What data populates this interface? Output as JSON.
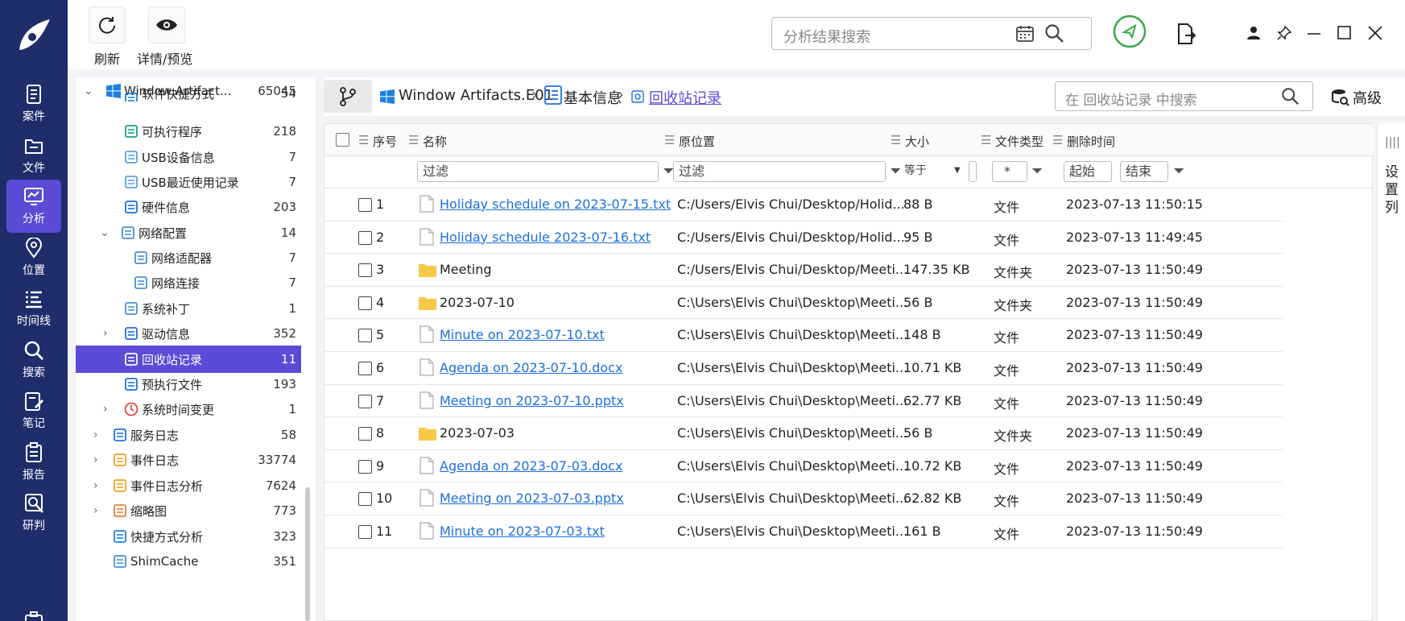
{
  "rail": {
    "items": [
      {
        "label": "案件",
        "icon": "case-icon"
      },
      {
        "label": "文件",
        "icon": "folder-icon"
      },
      {
        "label": "分析",
        "icon": "analysis-icon",
        "active": true
      },
      {
        "label": "位置",
        "icon": "location-icon"
      },
      {
        "label": "时间线",
        "icon": "timeline-icon"
      },
      {
        "label": "搜索",
        "icon": "search-icon"
      },
      {
        "label": "笔记",
        "icon": "note-icon"
      },
      {
        "label": "报告",
        "icon": "report-icon"
      },
      {
        "label": "研判",
        "icon": "judge-icon"
      }
    ]
  },
  "toolbar": {
    "refresh_label": "刷新",
    "preview_label": "详情/预览",
    "search_placeholder": "分析结果搜索"
  },
  "tree": {
    "items": [
      {
        "label": "Window Artifact...",
        "count": "65045",
        "icon": "windows-icon"
      },
      {
        "label": "软件快捷方式",
        "count": "54",
        "icon": "shortcut-icon"
      },
      {
        "label": "可执行程序",
        "count": "218",
        "icon": "exe-icon"
      },
      {
        "label": "USB设备信息",
        "count": "7",
        "icon": "usb-icon"
      },
      {
        "label": "USB最近使用记录",
        "count": "7",
        "icon": "usb-icon"
      },
      {
        "label": "硬件信息",
        "count": "203",
        "icon": "chip-icon"
      },
      {
        "label": "网络配置",
        "count": "14",
        "icon": "network-icon"
      },
      {
        "label": "网络适配器",
        "count": "7",
        "icon": "network-icon"
      },
      {
        "label": "网络连接",
        "count": "7",
        "icon": "network-icon"
      },
      {
        "label": "系统补丁",
        "count": "1",
        "icon": "patch-icon"
      },
      {
        "label": "驱动信息",
        "count": "352",
        "icon": "drive-icon"
      },
      {
        "label": "回收站记录",
        "count": "11",
        "icon": "recycle-icon",
        "selected": true
      },
      {
        "label": "预执行文件",
        "count": "193",
        "icon": "prefetch-icon"
      },
      {
        "label": "系统时间变更",
        "count": "1",
        "icon": "clock-icon"
      },
      {
        "label": "服务日志",
        "count": "58",
        "icon": "service-icon"
      },
      {
        "label": "事件日志",
        "count": "33774",
        "icon": "event-icon"
      },
      {
        "label": "事件日志分析",
        "count": "7624",
        "icon": "event-icon"
      },
      {
        "label": "缩略图",
        "count": "773",
        "icon": "thumb-icon"
      },
      {
        "label": "快捷方式分析",
        "count": "323",
        "icon": "shortcut-icon"
      },
      {
        "label": "ShimCache",
        "count": "351",
        "icon": "shim-icon"
      }
    ]
  },
  "breadcrumb": {
    "items": [
      "Window Artifacts.E01",
      "基本信息",
      "回收站记录"
    ],
    "search_placeholder": "在 回收站记录 中搜索",
    "advanced_label": "高级"
  },
  "grid": {
    "columns": [
      "序号",
      "名称",
      "原位置",
      "大小",
      "文件类型",
      "删除时间"
    ],
    "filters": {
      "name": "过滤",
      "location": "过滤",
      "size_op": "等于",
      "type": "*",
      "start": "起始",
      "end": "结束"
    },
    "rows": [
      {
        "no": "1",
        "name": "Holiday schedule on 2023-07-15.txt",
        "kind": "file",
        "loc": "C:/Users/Elvis Chui/Desktop/Holid...",
        "size": "88 B",
        "type": "文件",
        "time": "2023-07-13 11:50:15"
      },
      {
        "no": "2",
        "name": "Holiday schedule 2023-07-16.txt",
        "kind": "file",
        "loc": "C:/Users/Elvis Chui/Desktop/Holid...",
        "size": "95 B",
        "type": "文件",
        "time": "2023-07-13 11:49:45"
      },
      {
        "no": "3",
        "name": "Meeting",
        "kind": "folder",
        "loc": "C:/Users/Elvis Chui/Desktop/Meeti...",
        "size": "147.35 KB",
        "type": "文件夹",
        "time": "2023-07-13 11:50:49"
      },
      {
        "no": "4",
        "name": "2023-07-10",
        "kind": "folder",
        "loc": "C:\\Users\\Elvis Chui\\Desktop\\Meeti...",
        "size": "56 B",
        "type": "文件夹",
        "time": "2023-07-13 11:50:49"
      },
      {
        "no": "5",
        "name": "Minute on 2023-07-10.txt",
        "kind": "file",
        "loc": "C:\\Users\\Elvis Chui\\Desktop\\Meeti...",
        "size": "148 B",
        "type": "文件",
        "time": "2023-07-13 11:50:49"
      },
      {
        "no": "6",
        "name": "Agenda on 2023-07-10.docx",
        "kind": "file",
        "loc": "C:\\Users\\Elvis Chui\\Desktop\\Meeti...",
        "size": "10.71 KB",
        "type": "文件",
        "time": "2023-07-13 11:50:49"
      },
      {
        "no": "7",
        "name": "Meeting on 2023-07-10.pptx",
        "kind": "file",
        "loc": "C:\\Users\\Elvis Chui\\Desktop\\Meeti...",
        "size": "62.77 KB",
        "type": "文件",
        "time": "2023-07-13 11:50:49"
      },
      {
        "no": "8",
        "name": "2023-07-03",
        "kind": "folder",
        "loc": "C:\\Users\\Elvis Chui\\Desktop\\Meeti...",
        "size": "56 B",
        "type": "文件夹",
        "time": "2023-07-13 11:50:49"
      },
      {
        "no": "9",
        "name": "Agenda on 2023-07-03.docx",
        "kind": "file",
        "loc": "C:\\Users\\Elvis Chui\\Desktop\\Meeti...",
        "size": "10.72 KB",
        "type": "文件",
        "time": "2023-07-13 11:50:49"
      },
      {
        "no": "10",
        "name": "Meeting on 2023-07-03.pptx",
        "kind": "file",
        "loc": "C:\\Users\\Elvis Chui\\Desktop\\Meeti...",
        "size": "62.82 KB",
        "type": "文件",
        "time": "2023-07-13 11:50:49"
      },
      {
        "no": "11",
        "name": "Minute on 2023-07-03.txt",
        "kind": "file",
        "loc": "C:\\Users\\Elvis Chui\\Desktop\\Meeti...",
        "size": "161 B",
        "type": "文件",
        "time": "2023-07-13 11:50:49"
      }
    ]
  },
  "side_panel": {
    "label": "设置列"
  },
  "colors": {
    "rail": "#1f2d6b",
    "accent": "#5b4bd6",
    "link": "#1e6fe0",
    "pin_ring": "#3aa84a"
  }
}
